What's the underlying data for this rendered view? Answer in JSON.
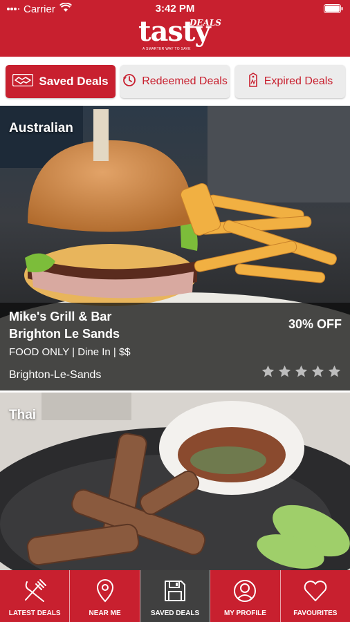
{
  "status_bar": {
    "carrier": "Carrier",
    "time": "3:42 PM"
  },
  "brand": {
    "name": "tasty",
    "badge": "DEALS",
    "tagline": "A SMARTER WAY TO SAVE"
  },
  "tabs": [
    {
      "label": "Saved Deals",
      "icon": "handshake-icon",
      "active": true
    },
    {
      "label": "Redeemed Deals",
      "icon": "history-icon",
      "active": false
    },
    {
      "label": "Expired Deals",
      "icon": "expired-tag-icon",
      "active": false
    }
  ],
  "deals": [
    {
      "cuisine": "Australian",
      "name_line1": "Mike's Grill & Bar",
      "name_line2": "Brighton Le Sands",
      "discount": "30% OFF",
      "terms": "FOOD ONLY | Dine In | $$",
      "suburb": "Brighton-Le-Sands",
      "rating": 0,
      "max_rating": 5
    },
    {
      "cuisine": "Thai"
    }
  ],
  "bottom_nav": [
    {
      "label": "LATEST DEALS",
      "icon": "fork-knife-icon"
    },
    {
      "label": "NEAR ME",
      "icon": "map-pin-icon"
    },
    {
      "label": "SAVED DEALS",
      "icon": "floppy-disk-icon",
      "active": true
    },
    {
      "label": "MY PROFILE",
      "icon": "user-icon"
    },
    {
      "label": "FAVOURITES",
      "icon": "heart-icon"
    }
  ],
  "colors": {
    "brand_red": "#c8202f",
    "active_nav": "#404040",
    "tab_inactive": "#ececec"
  }
}
